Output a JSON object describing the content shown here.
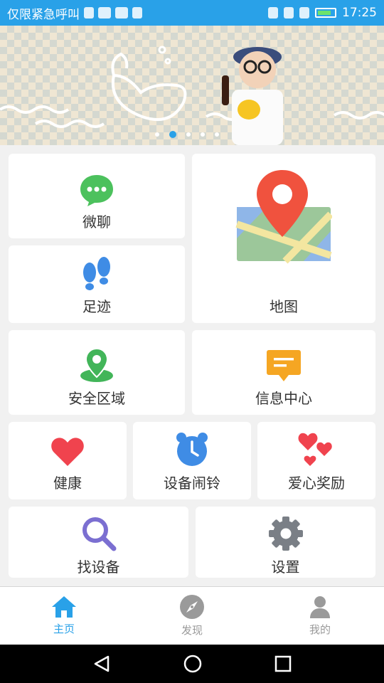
{
  "status_bar": {
    "left_text": "仅限紧急呼叫",
    "time": "17:25"
  },
  "banner": {
    "slide_count": 5,
    "active_slide": 1
  },
  "tiles": {
    "chat": {
      "label": "微聊",
      "icon": "chat-bubble-icon",
      "color": "#4cc15d"
    },
    "map": {
      "label": "地图",
      "icon": "map-pin-icon",
      "color": "#f0523e"
    },
    "footprint": {
      "label": "足迹",
      "icon": "footprints-icon",
      "color": "#3f8ce5"
    },
    "safe_zone": {
      "label": "安全区域",
      "icon": "location-zone-icon",
      "color": "#42b559"
    },
    "message_center": {
      "label": "信息中心",
      "icon": "message-icon",
      "color": "#f5a623"
    },
    "health": {
      "label": "健康",
      "icon": "heart-icon",
      "color": "#f0434e"
    },
    "alarm": {
      "label": "设备闹铃",
      "icon": "alarm-clock-icon",
      "color": "#3f8ce5"
    },
    "reward": {
      "label": "爱心奖励",
      "icon": "hearts-icon",
      "color": "#f0434e"
    },
    "find_device": {
      "label": "找设备",
      "icon": "search-icon",
      "color": "#7b6fd1"
    },
    "settings": {
      "label": "设置",
      "icon": "gear-icon",
      "color": "#7a7f86"
    }
  },
  "tab_bar": {
    "home": {
      "label": "主页",
      "icon": "home-icon",
      "active": true
    },
    "discover": {
      "label": "发现",
      "icon": "compass-icon",
      "active": false
    },
    "mine": {
      "label": "我的",
      "icon": "person-icon",
      "active": false
    }
  },
  "colors": {
    "accent": "#29a1e8",
    "background": "#f1f1f1"
  }
}
